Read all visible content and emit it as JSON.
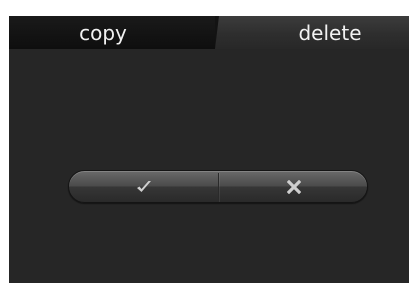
{
  "tabs": [
    {
      "label": "copy",
      "selected": false
    },
    {
      "label": "delete",
      "selected": true
    }
  ],
  "dialog": {
    "confirm_icon": "check-icon",
    "cancel_icon": "x-icon"
  },
  "colors": {
    "screen_background": "#262626",
    "tab_bar_background": "#131313",
    "active_tab": "#363636",
    "text": "#f2f2f2",
    "icon": "#d0d0d0"
  }
}
